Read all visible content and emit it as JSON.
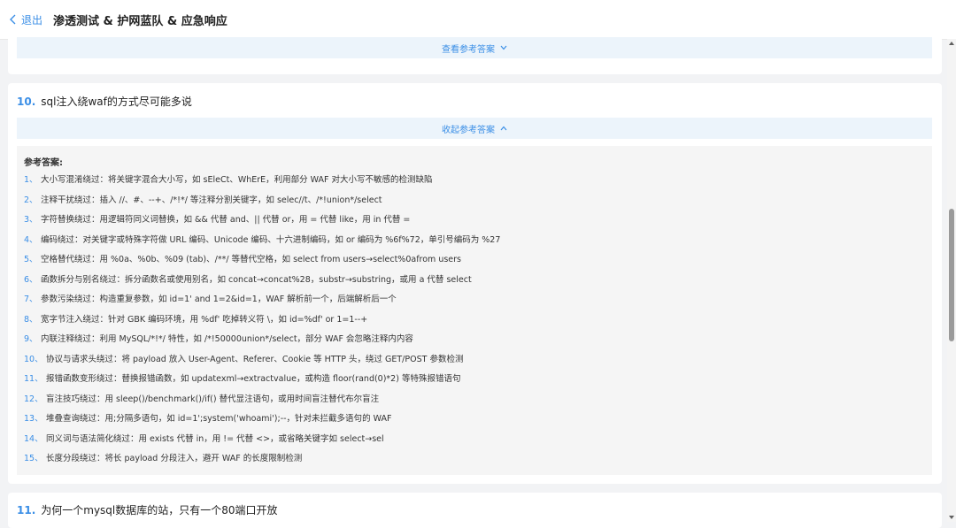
{
  "header": {
    "back_label": "退出",
    "title": "渗透测试 & 护网蓝队 & 应急响应"
  },
  "card1": {
    "toggle_label": "查看参考答案"
  },
  "question10": {
    "number": "10.",
    "text": "sql注入绕waf的方式尽可能多说",
    "toggle_label": "收起参考答案",
    "answer_heading": "参考答案:",
    "items": [
      {
        "idx": "1、",
        "text": "大小写混淆绕过：将关键字混合大小写，如 sEleCt、WhErE，利用部分 WAF 对大小写不敏感的检测缺陷"
      },
      {
        "idx": "2、",
        "text": "注释干扰绕过：插入 //、#、--+、/*!*/ 等注释分割关键字，如 selec//t、/*!union*/select"
      },
      {
        "idx": "3、",
        "text": "字符替换绕过：用逻辑符同义词替换，如 && 代替 and、|| 代替 or，用 = 代替 like，用 in 代替 ="
      },
      {
        "idx": "4、",
        "text": "编码绕过：对关键字或特殊字符做 URL 编码、Unicode 编码、十六进制编码，如 or 编码为 %6f%72，单引号编码为 %27"
      },
      {
        "idx": "5、",
        "text": "空格替代绕过：用 %0a、%0b、%09 (tab)、/**/ 等替代空格，如 select from users→select%0afrom users"
      },
      {
        "idx": "6、",
        "text": "函数拆分与别名绕过：拆分函数名或使用别名，如 concat→concat%28，substr→substring，或用 a 代替 select"
      },
      {
        "idx": "7、",
        "text": "参数污染绕过：构造重复参数，如 id=1' and 1=2&id=1，WAF 解析前一个，后端解析后一个"
      },
      {
        "idx": "8、",
        "text": "宽字节注入绕过：针对 GBK 编码环境，用 %df' 吃掉转义符 \\，如 id=%df' or 1=1--+"
      },
      {
        "idx": "9、",
        "text": "内联注释绕过：利用 MySQL/*!*/ 特性，如 /*!50000union*/select，部分 WAF 会忽略注释内内容"
      },
      {
        "idx": "10、",
        "text": "协议与请求头绕过：将 payload 放入 User-Agent、Referer、Cookie 等 HTTP 头，绕过 GET/POST 参数检测"
      },
      {
        "idx": "11、",
        "text": "报错函数变形绕过：替换报错函数，如 updatexml→extractvalue，或构造 floor(rand(0)*2) 等特殊报错语句"
      },
      {
        "idx": "12、",
        "text": "盲注技巧绕过：用 sleep()/benchmark()/if() 替代显注语句，或用时间盲注替代布尔盲注"
      },
      {
        "idx": "13、",
        "text": "堆叠查询绕过：用;分隔多语句，如 id=1';system('whoami');--，针对未拦截多语句的 WAF"
      },
      {
        "idx": "14、",
        "text": "同义词与语法简化绕过：用 exists 代替 in，用 != 代替 <>，或省略关键字如 select→sel"
      },
      {
        "idx": "15、",
        "text": "长度分段绕过：将长 payload 分段注入，避开 WAF 的长度限制检测"
      }
    ]
  },
  "question11": {
    "number": "11.",
    "text": "为何一个mysql数据库的站，只有一个80端口开放"
  },
  "colors": {
    "accent": "#3a8ee6",
    "toggle_bg": "#ecf4fb",
    "answer_bg": "#f5f5f5",
    "page_bg": "#f2f3f5"
  }
}
